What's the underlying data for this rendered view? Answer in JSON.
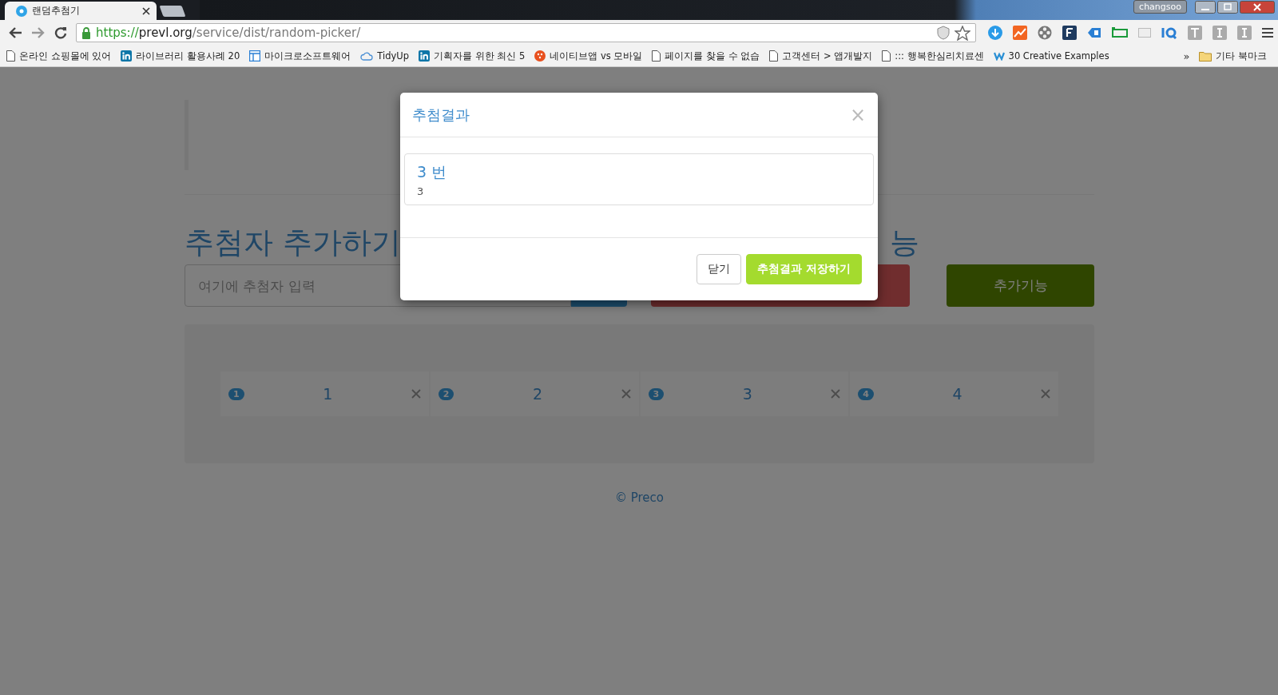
{
  "browser": {
    "tabs": [
      {
        "title": "랜덤추첨기",
        "selected": true
      }
    ],
    "user": "changsoo",
    "address": {
      "scheme": "https://",
      "host": "prevl.org",
      "path": "/service/dist/random-picker/"
    },
    "bookmarks": [
      {
        "label": "온라인 쇼핑몰에 있어",
        "kind": "page"
      },
      {
        "label": "라이브러리 활용사례 20",
        "kind": "linkedin"
      },
      {
        "label": "마이크로소프트웨어",
        "kind": "layout"
      },
      {
        "label": "TidyUp",
        "kind": "cloud"
      },
      {
        "label": "기획자를 위한 최신 5",
        "kind": "linkedin"
      },
      {
        "label": "네이티브앱 vs 모바일",
        "kind": "badge"
      },
      {
        "label": "페이지를 찾을 수 없습",
        "kind": "page"
      },
      {
        "label": "고객센터 > 앱개발지",
        "kind": "page"
      },
      {
        "label": "::: 행복한심리치료센",
        "kind": "page"
      },
      {
        "label": "30 Creative Examples",
        "kind": "w"
      }
    ],
    "bookmarks_overflow": "»",
    "other_bookmarks": "기타 북마크"
  },
  "page": {
    "heading": "추첨자 추가하기",
    "heading_fragment": "능",
    "input": {
      "placeholder": "여기에 추첨자 입력"
    },
    "extra_button": "추가기능",
    "entries": [
      {
        "number": "1",
        "name": "1"
      },
      {
        "number": "2",
        "name": "2"
      },
      {
        "number": "3",
        "name": "3"
      },
      {
        "number": "4",
        "name": "4"
      }
    ],
    "footer": "© Preco"
  },
  "modal": {
    "title": "추첨결과",
    "close": "×",
    "result": {
      "title": "3 번",
      "detail": "3"
    },
    "buttons": [
      {
        "label": "닫기",
        "kind": "default"
      },
      {
        "label": "추첨결과 저장하기",
        "kind": "primary"
      }
    ]
  }
}
